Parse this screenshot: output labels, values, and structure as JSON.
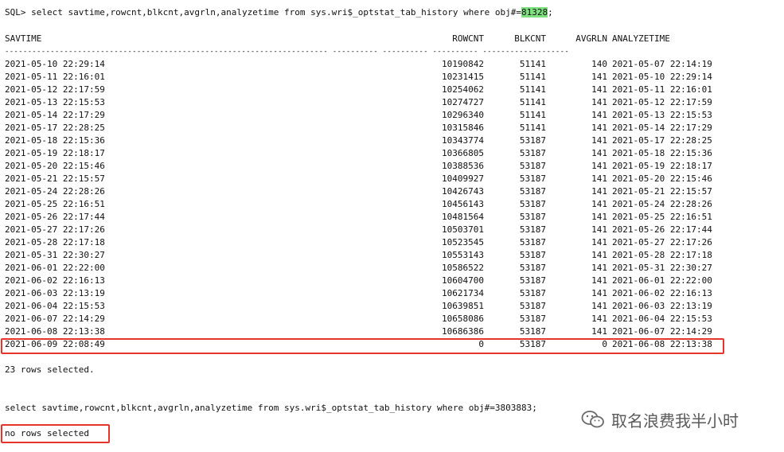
{
  "query1": {
    "prefix": "SQL> select savtime,rowcnt,blkcnt,avgrln,analyzetime from sys.wri$_optstat_tab_history where obj#=",
    "obj": "81328",
    "suffix": ";"
  },
  "headers": {
    "savtime": "SAVTIME",
    "rowcnt": "ROWCNT",
    "blkcnt": "BLKCNT",
    "avgrln": "AVGRLN",
    "analyzetime": "ANALYZETIME"
  },
  "separator": "----------------------------------------------------------------------- ---------- ---------- ---------- -------------------",
  "rows": [
    {
      "savtime": "2021-05-10 22:29:14",
      "rowcnt": "10190842",
      "blkcnt": "51141",
      "avgrln": "140",
      "analyzetime": "2021-05-07 22:14:19"
    },
    {
      "savtime": "2021-05-11 22:16:01",
      "rowcnt": "10231415",
      "blkcnt": "51141",
      "avgrln": "141",
      "analyzetime": "2021-05-10 22:29:14"
    },
    {
      "savtime": "2021-05-12 22:17:59",
      "rowcnt": "10254062",
      "blkcnt": "51141",
      "avgrln": "141",
      "analyzetime": "2021-05-11 22:16:01"
    },
    {
      "savtime": "2021-05-13 22:15:53",
      "rowcnt": "10274727",
      "blkcnt": "51141",
      "avgrln": "141",
      "analyzetime": "2021-05-12 22:17:59"
    },
    {
      "savtime": "2021-05-14 22:17:29",
      "rowcnt": "10296340",
      "blkcnt": "51141",
      "avgrln": "141",
      "analyzetime": "2021-05-13 22:15:53"
    },
    {
      "savtime": "2021-05-17 22:28:25",
      "rowcnt": "10315846",
      "blkcnt": "51141",
      "avgrln": "141",
      "analyzetime": "2021-05-14 22:17:29"
    },
    {
      "savtime": "2021-05-18 22:15:36",
      "rowcnt": "10343774",
      "blkcnt": "53187",
      "avgrln": "141",
      "analyzetime": "2021-05-17 22:28:25"
    },
    {
      "savtime": "2021-05-19 22:18:17",
      "rowcnt": "10366805",
      "blkcnt": "53187",
      "avgrln": "141",
      "analyzetime": "2021-05-18 22:15:36"
    },
    {
      "savtime": "2021-05-20 22:15:46",
      "rowcnt": "10388536",
      "blkcnt": "53187",
      "avgrln": "141",
      "analyzetime": "2021-05-19 22:18:17"
    },
    {
      "savtime": "2021-05-21 22:15:57",
      "rowcnt": "10409927",
      "blkcnt": "53187",
      "avgrln": "141",
      "analyzetime": "2021-05-20 22:15:46"
    },
    {
      "savtime": "2021-05-24 22:28:26",
      "rowcnt": "10426743",
      "blkcnt": "53187",
      "avgrln": "141",
      "analyzetime": "2021-05-21 22:15:57"
    },
    {
      "savtime": "2021-05-25 22:16:51",
      "rowcnt": "10456143",
      "blkcnt": "53187",
      "avgrln": "141",
      "analyzetime": "2021-05-24 22:28:26"
    },
    {
      "savtime": "2021-05-26 22:17:44",
      "rowcnt": "10481564",
      "blkcnt": "53187",
      "avgrln": "141",
      "analyzetime": "2021-05-25 22:16:51"
    },
    {
      "savtime": "2021-05-27 22:17:26",
      "rowcnt": "10503701",
      "blkcnt": "53187",
      "avgrln": "141",
      "analyzetime": "2021-05-26 22:17:44"
    },
    {
      "savtime": "2021-05-28 22:17:18",
      "rowcnt": "10523545",
      "blkcnt": "53187",
      "avgrln": "141",
      "analyzetime": "2021-05-27 22:17:26"
    },
    {
      "savtime": "2021-05-31 22:30:27",
      "rowcnt": "10553143",
      "blkcnt": "53187",
      "avgrln": "141",
      "analyzetime": "2021-05-28 22:17:18"
    },
    {
      "savtime": "2021-06-01 22:22:00",
      "rowcnt": "10586522",
      "blkcnt": "53187",
      "avgrln": "141",
      "analyzetime": "2021-05-31 22:30:27"
    },
    {
      "savtime": "2021-06-02 22:16:13",
      "rowcnt": "10604700",
      "blkcnt": "53187",
      "avgrln": "141",
      "analyzetime": "2021-06-01 22:22:00"
    },
    {
      "savtime": "2021-06-03 22:13:19",
      "rowcnt": "10621734",
      "blkcnt": "53187",
      "avgrln": "141",
      "analyzetime": "2021-06-02 22:16:13"
    },
    {
      "savtime": "2021-06-04 22:15:53",
      "rowcnt": "10639851",
      "blkcnt": "53187",
      "avgrln": "141",
      "analyzetime": "2021-06-03 22:13:19"
    },
    {
      "savtime": "2021-06-07 22:14:29",
      "rowcnt": "10658086",
      "blkcnt": "53187",
      "avgrln": "141",
      "analyzetime": "2021-06-04 22:15:53"
    },
    {
      "savtime": "2021-06-08 22:13:38",
      "rowcnt": "10686386",
      "blkcnt": "53187",
      "avgrln": "141",
      "analyzetime": "2021-06-07 22:14:29"
    },
    {
      "savtime": "2021-06-09 22:08:49",
      "rowcnt": "0",
      "blkcnt": "53187",
      "avgrln": "0",
      "analyzetime": "2021-06-08 22:13:38"
    }
  ],
  "rows_selected": "23 rows selected.",
  "query2": "select savtime,rowcnt,blkcnt,avgrln,analyzetime from sys.wri$_optstat_tab_history where obj#=3803883;",
  "no_rows": "no rows selected",
  "watermark": {
    "text": "取名浪费我半小时",
    "icon": "wechat-icon"
  },
  "colors": {
    "highlight": "#7ee07e",
    "box": "#e8352b"
  }
}
